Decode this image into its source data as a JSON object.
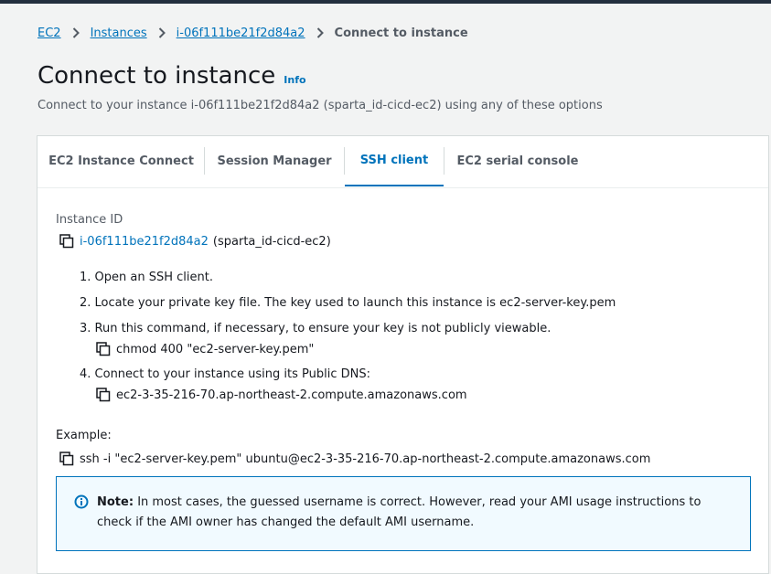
{
  "breadcrumb": {
    "items": [
      "EC2",
      "Instances",
      "i-06f111be21f2d84a2"
    ],
    "current": "Connect to instance"
  },
  "header": {
    "title": "Connect to instance",
    "info_label": "Info",
    "subtitle": "Connect to your instance i-06f111be21f2d84a2 (sparta_id-cicd-ec2) using any of these options"
  },
  "tabs": [
    {
      "label": "EC2 Instance Connect",
      "active": false
    },
    {
      "label": "Session Manager",
      "active": false
    },
    {
      "label": "SSH client",
      "active": true
    },
    {
      "label": "EC2 serial console",
      "active": false
    }
  ],
  "instance": {
    "label": "Instance ID",
    "id": "i-06f111be21f2d84a2",
    "name": "(sparta_id-cicd-ec2)"
  },
  "steps": [
    {
      "text": "1. Open an SSH client."
    },
    {
      "text": "2. Locate your private key file. The key used to launch this instance is ec2-server-key.pem"
    },
    {
      "text": "3. Run this command, if necessary, to ensure your key is not publicly viewable.",
      "command": "chmod 400 \"ec2-server-key.pem\""
    },
    {
      "text": "4. Connect to your instance using its Public DNS:",
      "command": "ec2-3-35-216-70.ap-northeast-2.compute.amazonaws.com"
    }
  ],
  "example": {
    "label": "Example:",
    "command": "ssh -i \"ec2-server-key.pem\" ubuntu@ec2-3-35-216-70.ap-northeast-2.compute.amazonaws.com"
  },
  "note": {
    "title": "Note:",
    "text": "In most cases, the guessed username is correct. However, read your AMI usage instructions to check if the AMI owner has changed the default AMI username."
  },
  "icons": {
    "copy": "copy-icon",
    "info": "info-circle-icon",
    "chevron": "chevron-right-icon"
  },
  "colors": {
    "link": "#0073bb",
    "page_bg": "#f2f3f3",
    "text": "#16191f",
    "muted": "#545b64",
    "note_bg": "#f1faff"
  }
}
